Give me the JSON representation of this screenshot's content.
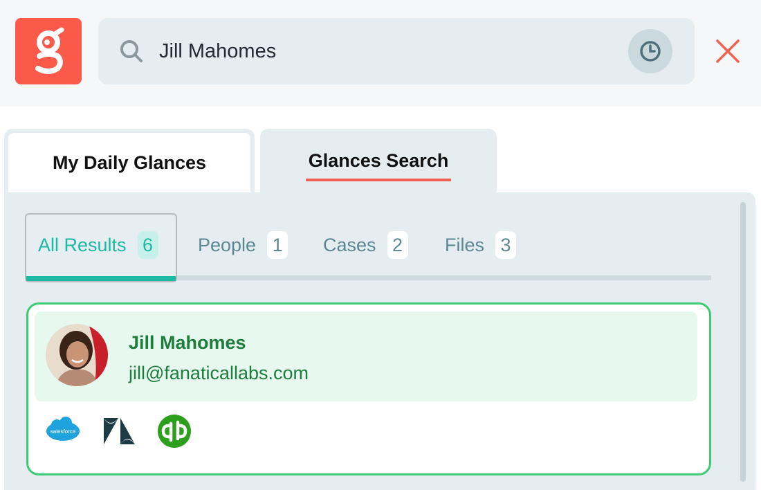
{
  "search": {
    "query": "Jill Mahomes"
  },
  "icons": {
    "logo": "glances-logo",
    "search": "search-icon",
    "history": "clock-history-icon",
    "close": "close-icon"
  },
  "main_tabs": [
    {
      "label": "My Daily Glances",
      "active": false
    },
    {
      "label": "Glances Search",
      "active": true
    }
  ],
  "sub_tabs": [
    {
      "label": "All Results",
      "count": "6",
      "active": true
    },
    {
      "label": "People",
      "count": "1",
      "active": false
    },
    {
      "label": "Cases",
      "count": "2",
      "active": false
    },
    {
      "label": "Files",
      "count": "3",
      "active": false
    }
  ],
  "result": {
    "name": "Jill Mahomes",
    "email": "jill@fanaticallabs.com",
    "integrations": [
      {
        "name": "salesforce-icon",
        "label": "salesforce"
      },
      {
        "name": "zendesk-icon"
      },
      {
        "name": "quickbooks-icon"
      }
    ]
  },
  "colors": {
    "brand": "#fb5a4a",
    "accent_teal": "#1fb8a5",
    "result_green": "#3bcc73",
    "close_red": "#f0614f"
  }
}
